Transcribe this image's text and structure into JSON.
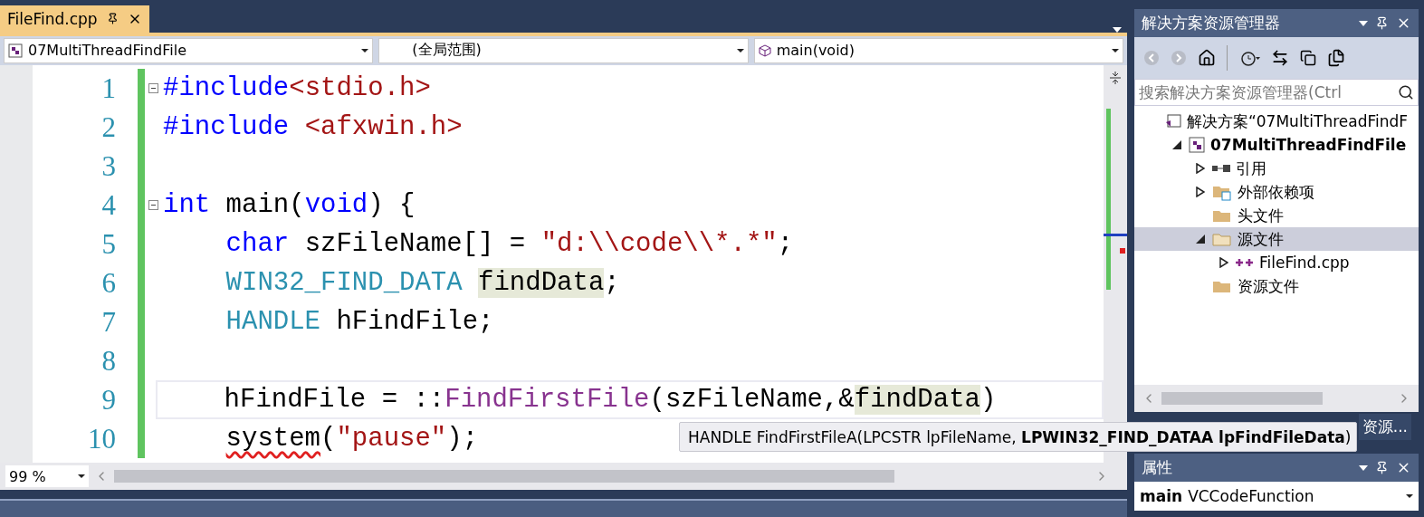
{
  "editor": {
    "tab": {
      "title": "FileFind.cpp",
      "selected": true
    },
    "nav": [
      {
        "kind": "project",
        "text": "07MultiThreadFindFile"
      },
      {
        "kind": "scope",
        "text": "(全局范围)"
      },
      {
        "kind": "member",
        "text": "main(void)"
      }
    ],
    "lines": [
      {
        "number": "1",
        "fold": true,
        "current": false,
        "tokens": [
          {
            "kind": "preproc",
            "text": "#include"
          },
          {
            "kind": "string",
            "text": "<stdio.h>"
          }
        ]
      },
      {
        "number": "2",
        "fold": false,
        "current": false,
        "tokens": [
          {
            "kind": "preproc",
            "text": "#include"
          },
          {
            "kind": "string",
            "text": " <afxwin.h>"
          }
        ]
      },
      {
        "number": "3",
        "fold": false,
        "current": false
      },
      {
        "number": "4",
        "fold": true,
        "current": false,
        "tokens": [
          {
            "kind": "keyword",
            "text": "int"
          },
          {
            "kind": "plain",
            "text": " main("
          },
          {
            "kind": "keyword",
            "text": "void"
          },
          {
            "kind": "plain",
            "text": ") {"
          }
        ]
      },
      {
        "number": "5",
        "fold": false,
        "current": false,
        "indent": true,
        "tokens": [
          {
            "kind": "keyword",
            "text": "char"
          },
          {
            "kind": "plain",
            "text": " szFileName[] = "
          },
          {
            "kind": "string",
            "text": "\"d:\\\\code\\\\*.*\""
          },
          {
            "kind": "plain",
            "text": ";"
          }
        ]
      },
      {
        "number": "6",
        "fold": false,
        "current": false,
        "indent": true,
        "tokens": [
          {
            "kind": "type",
            "text": "WIN32_FIND_DATA "
          },
          {
            "kind": "plain",
            "text": "findData",
            "highlighted": true
          },
          {
            "kind": "plain",
            "text": ";"
          }
        ]
      },
      {
        "number": "7",
        "fold": false,
        "current": false,
        "indent": true,
        "tokens": [
          {
            "kind": "type",
            "text": "HANDLE"
          },
          {
            "kind": "plain",
            "text": " hFindFile;"
          }
        ]
      },
      {
        "number": "8",
        "fold": false,
        "current": false
      },
      {
        "number": "9",
        "fold": false,
        "current": true,
        "indent": true,
        "tokens": [
          {
            "kind": "plain",
            "text": "hFindFile = ::"
          },
          {
            "kind": "func",
            "text": "FindFirstFile"
          },
          {
            "kind": "plain",
            "text": "(szFileName,&"
          },
          {
            "kind": "plain",
            "text": "findData",
            "highlighted": true
          },
          {
            "kind": "plain",
            "text": ")"
          }
        ]
      },
      {
        "number": "10",
        "fold": false,
        "current": false,
        "indent": true,
        "tokens": [
          {
            "kind": "plain",
            "text": "system",
            "squiggle": true
          },
          {
            "kind": "plain",
            "text": "("
          },
          {
            "kind": "string",
            "text": "\"pause\""
          },
          {
            "kind": "plain",
            "text": ");"
          }
        ]
      }
    ],
    "zoom": "99 %",
    "tooltip": "HANDLE FindFirstFileA(LPCSTR lpFileName, **LPWIN32_FIND_DATAA lpFindFileData**)"
  },
  "solution_explorer": {
    "title": "解决方案资源管理器",
    "search": {
      "placeholder": "搜索解决方案资源管理器(Ctrl"
    },
    "tree": [
      {
        "kind": "solution",
        "label": "解决方案“07MultiThreadFindF",
        "selected": false,
        "children": [
          {
            "kind": "project",
            "label": "07MultiThreadFindFile",
            "expanded": true,
            "selected": false,
            "children": [
              {
                "kind": "refs",
                "label": "引用",
                "expanded": false,
                "selected": false
              },
              {
                "kind": "external",
                "label": "外部依赖项",
                "expanded": false,
                "selected": false
              },
              {
                "kind": "folder",
                "label": "头文件",
                "selected": false
              },
              {
                "kind": "folder-open",
                "label": "源文件",
                "expanded": true,
                "selected": true,
                "children": [
                  {
                    "kind": "cpp",
                    "label": "FileFind.cpp",
                    "expanded": false,
                    "selected": false
                  }
                ]
              },
              {
                "kind": "folder",
                "label": "资源文件",
                "selected": false
              }
            ]
          }
        ]
      }
    ],
    "bottom_tab": "资源..."
  },
  "properties": {
    "title": "属性",
    "object_name": "main",
    "object_type": "VCCodeFunction"
  }
}
